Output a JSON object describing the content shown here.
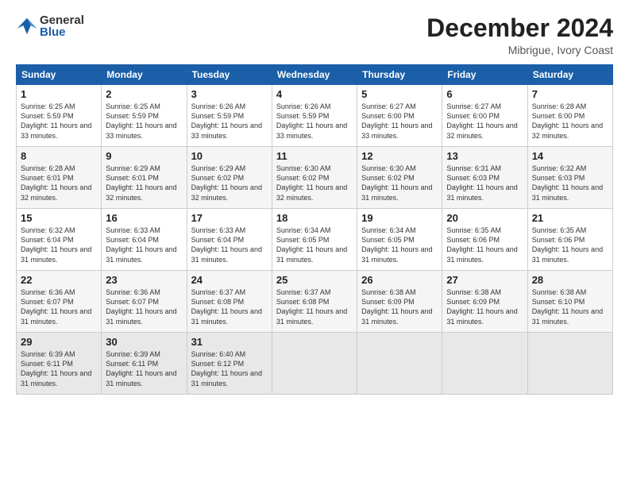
{
  "header": {
    "logo": {
      "general": "General",
      "blue": "Blue"
    },
    "title": "December 2024",
    "location": "Mibrigue, Ivory Coast"
  },
  "days_of_week": [
    "Sunday",
    "Monday",
    "Tuesday",
    "Wednesday",
    "Thursday",
    "Friday",
    "Saturday"
  ],
  "weeks": [
    [
      {
        "day": "1",
        "info": "Sunrise: 6:25 AM\nSunset: 5:59 PM\nDaylight: 11 hours\nand 33 minutes."
      },
      {
        "day": "2",
        "info": "Sunrise: 6:25 AM\nSunset: 5:59 PM\nDaylight: 11 hours\nand 33 minutes."
      },
      {
        "day": "3",
        "info": "Sunrise: 6:26 AM\nSunset: 5:59 PM\nDaylight: 11 hours\nand 33 minutes."
      },
      {
        "day": "4",
        "info": "Sunrise: 6:26 AM\nSunset: 5:59 PM\nDaylight: 11 hours\nand 33 minutes."
      },
      {
        "day": "5",
        "info": "Sunrise: 6:27 AM\nSunset: 6:00 PM\nDaylight: 11 hours\nand 33 minutes."
      },
      {
        "day": "6",
        "info": "Sunrise: 6:27 AM\nSunset: 6:00 PM\nDaylight: 11 hours\nand 32 minutes."
      },
      {
        "day": "7",
        "info": "Sunrise: 6:28 AM\nSunset: 6:00 PM\nDaylight: 11 hours\nand 32 minutes."
      }
    ],
    [
      {
        "day": "8",
        "info": "Sunrise: 6:28 AM\nSunset: 6:01 PM\nDaylight: 11 hours\nand 32 minutes."
      },
      {
        "day": "9",
        "info": "Sunrise: 6:29 AM\nSunset: 6:01 PM\nDaylight: 11 hours\nand 32 minutes."
      },
      {
        "day": "10",
        "info": "Sunrise: 6:29 AM\nSunset: 6:02 PM\nDaylight: 11 hours\nand 32 minutes."
      },
      {
        "day": "11",
        "info": "Sunrise: 6:30 AM\nSunset: 6:02 PM\nDaylight: 11 hours\nand 32 minutes."
      },
      {
        "day": "12",
        "info": "Sunrise: 6:30 AM\nSunset: 6:02 PM\nDaylight: 11 hours\nand 31 minutes."
      },
      {
        "day": "13",
        "info": "Sunrise: 6:31 AM\nSunset: 6:03 PM\nDaylight: 11 hours\nand 31 minutes."
      },
      {
        "day": "14",
        "info": "Sunrise: 6:32 AM\nSunset: 6:03 PM\nDaylight: 11 hours\nand 31 minutes."
      }
    ],
    [
      {
        "day": "15",
        "info": "Sunrise: 6:32 AM\nSunset: 6:04 PM\nDaylight: 11 hours\nand 31 minutes."
      },
      {
        "day": "16",
        "info": "Sunrise: 6:33 AM\nSunset: 6:04 PM\nDaylight: 11 hours\nand 31 minutes."
      },
      {
        "day": "17",
        "info": "Sunrise: 6:33 AM\nSunset: 6:04 PM\nDaylight: 11 hours\nand 31 minutes."
      },
      {
        "day": "18",
        "info": "Sunrise: 6:34 AM\nSunset: 6:05 PM\nDaylight: 11 hours\nand 31 minutes."
      },
      {
        "day": "19",
        "info": "Sunrise: 6:34 AM\nSunset: 6:05 PM\nDaylight: 11 hours\nand 31 minutes."
      },
      {
        "day": "20",
        "info": "Sunrise: 6:35 AM\nSunset: 6:06 PM\nDaylight: 11 hours\nand 31 minutes."
      },
      {
        "day": "21",
        "info": "Sunrise: 6:35 AM\nSunset: 6:06 PM\nDaylight: 11 hours\nand 31 minutes."
      }
    ],
    [
      {
        "day": "22",
        "info": "Sunrise: 6:36 AM\nSunset: 6:07 PM\nDaylight: 11 hours\nand 31 minutes."
      },
      {
        "day": "23",
        "info": "Sunrise: 6:36 AM\nSunset: 6:07 PM\nDaylight: 11 hours\nand 31 minutes."
      },
      {
        "day": "24",
        "info": "Sunrise: 6:37 AM\nSunset: 6:08 PM\nDaylight: 11 hours\nand 31 minutes."
      },
      {
        "day": "25",
        "info": "Sunrise: 6:37 AM\nSunset: 6:08 PM\nDaylight: 11 hours\nand 31 minutes."
      },
      {
        "day": "26",
        "info": "Sunrise: 6:38 AM\nSunset: 6:09 PM\nDaylight: 11 hours\nand 31 minutes."
      },
      {
        "day": "27",
        "info": "Sunrise: 6:38 AM\nSunset: 6:09 PM\nDaylight: 11 hours\nand 31 minutes."
      },
      {
        "day": "28",
        "info": "Sunrise: 6:38 AM\nSunset: 6:10 PM\nDaylight: 11 hours\nand 31 minutes."
      }
    ],
    [
      {
        "day": "29",
        "info": "Sunrise: 6:39 AM\nSunset: 6:11 PM\nDaylight: 11 hours\nand 31 minutes."
      },
      {
        "day": "30",
        "info": "Sunrise: 6:39 AM\nSunset: 6:11 PM\nDaylight: 11 hours\nand 31 minutes."
      },
      {
        "day": "31",
        "info": "Sunrise: 6:40 AM\nSunset: 6:12 PM\nDaylight: 11 hours\nand 31 minutes."
      },
      {
        "day": "",
        "info": ""
      },
      {
        "day": "",
        "info": ""
      },
      {
        "day": "",
        "info": ""
      },
      {
        "day": "",
        "info": ""
      }
    ]
  ]
}
